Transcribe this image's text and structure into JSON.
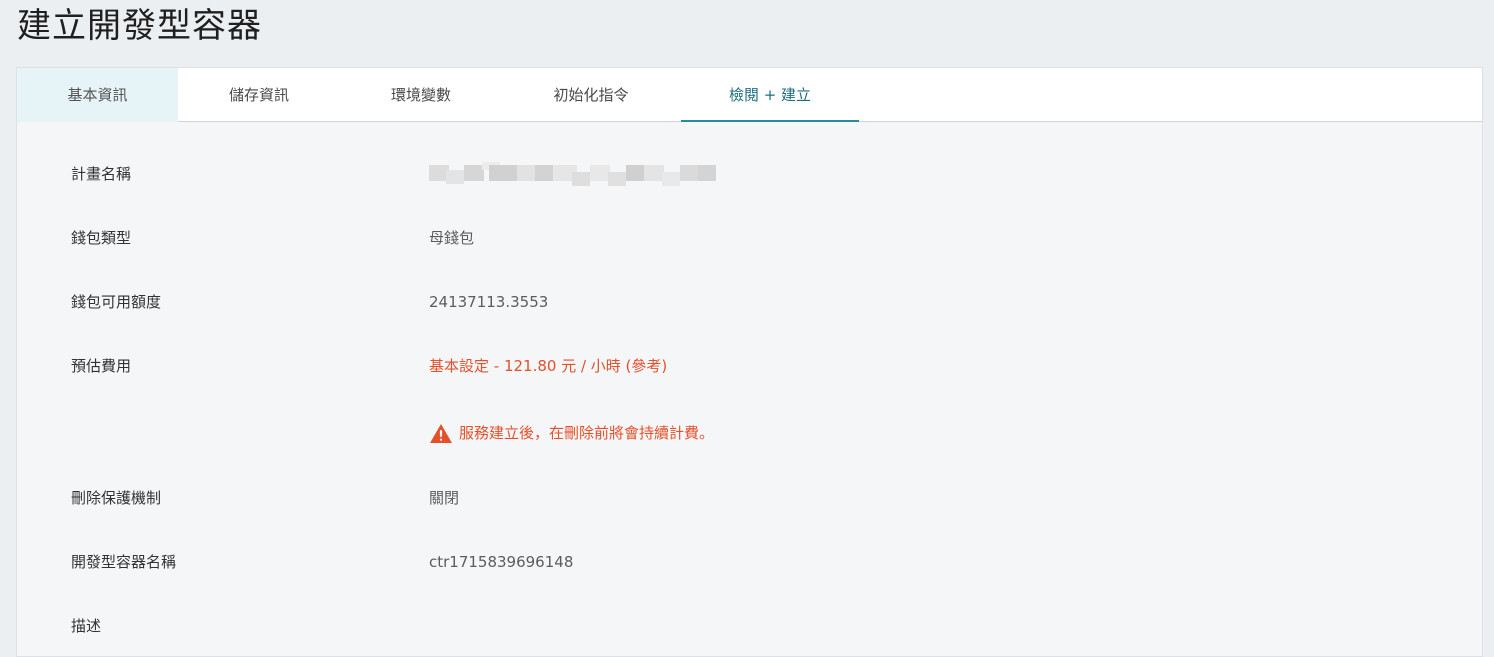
{
  "page": {
    "title": "建立開發型容器"
  },
  "tabs": [
    {
      "label": "基本資訊",
      "state": "completed"
    },
    {
      "label": "儲存資訊",
      "state": "default"
    },
    {
      "label": "環境變數",
      "state": "default"
    },
    {
      "label": "初始化指令",
      "state": "default"
    },
    {
      "label": "檢閱 + 建立",
      "state": "active"
    }
  ],
  "review": {
    "project_name": {
      "label": "計畫名稱"
    },
    "wallet_type": {
      "label": "錢包類型",
      "value": "母錢包"
    },
    "wallet_balance": {
      "label": "錢包可用額度",
      "value": "24137113.3553"
    },
    "estimated_cost": {
      "label": "預估費用",
      "value": "基本設定 - 121.80 元 / 小時 (參考)"
    },
    "billing_warning": {
      "icon": "warning-triangle-icon",
      "text": "服務建立後，在刪除前將會持續計費。"
    },
    "delete_protection": {
      "label": "刪除保護機制",
      "value": "關閉"
    },
    "container_name": {
      "label": "開發型容器名稱",
      "value": "ctr1715839696148"
    },
    "description": {
      "label": "描述"
    }
  },
  "colors": {
    "accent": "#2a8aa0",
    "warning": "#e5502a",
    "completed_tab_bg": "#e6f3f7"
  }
}
